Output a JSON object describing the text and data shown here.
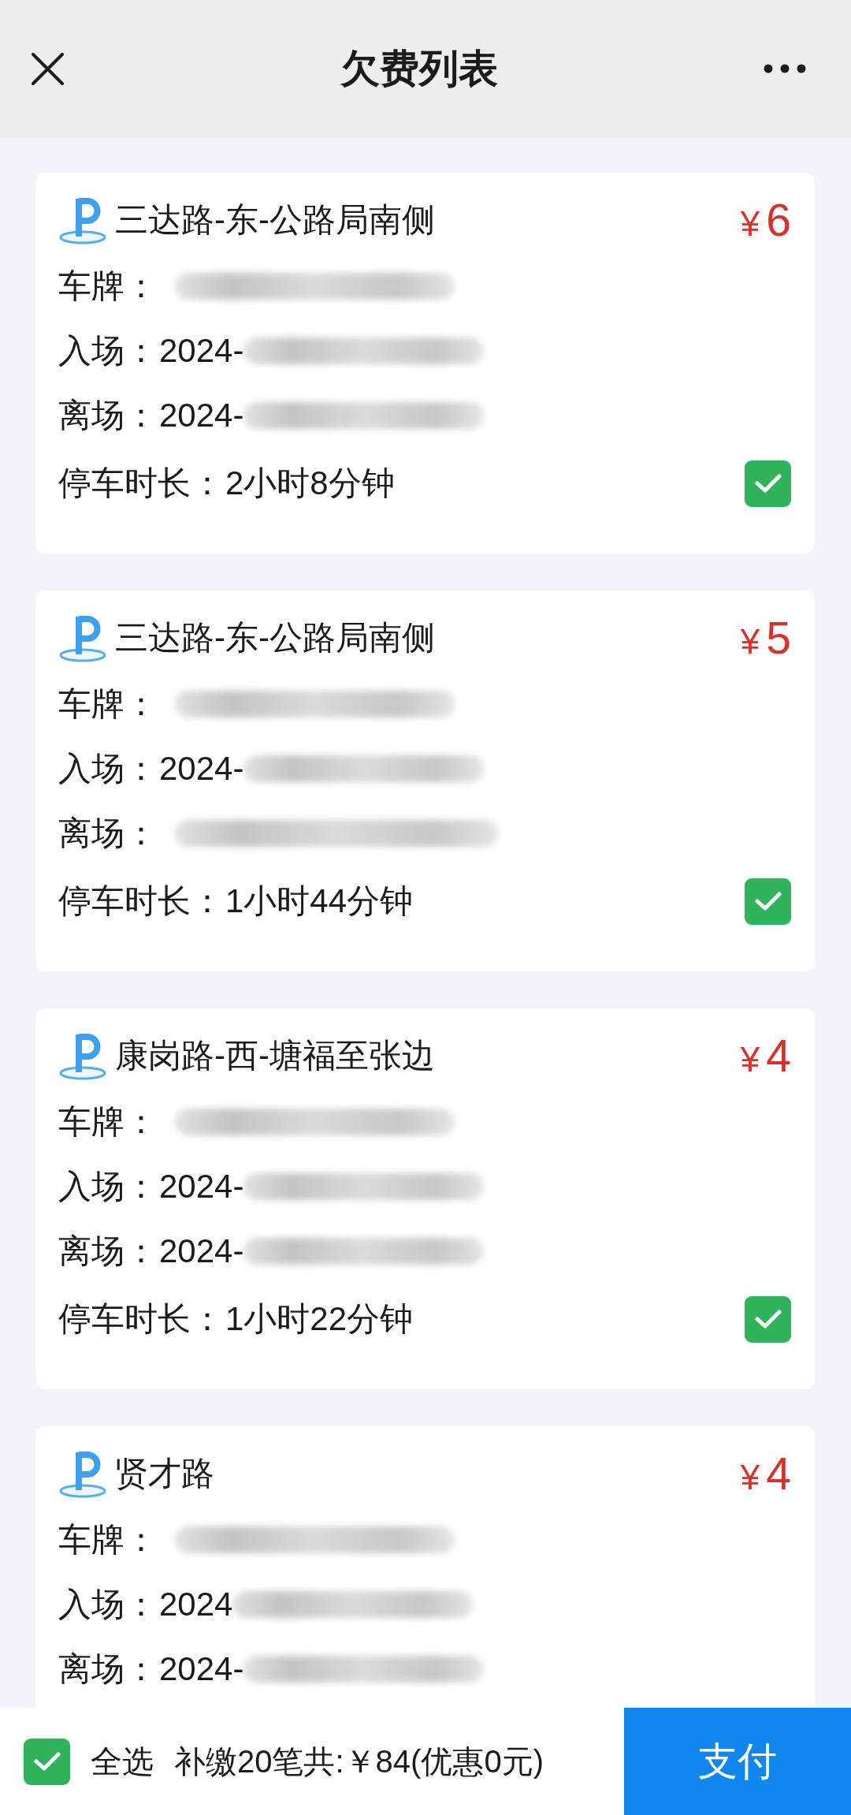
{
  "header": {
    "title": "欠费列表"
  },
  "cards": [
    {
      "location": "三达路-东-公路局南侧",
      "currency": "¥",
      "amount": "6",
      "fields": [
        {
          "kind": "plate",
          "label": "车牌：",
          "redacted": true
        },
        {
          "kind": "time",
          "label": "入场：",
          "value": "2024-",
          "redacted": true
        },
        {
          "kind": "time",
          "label": "离场：",
          "value": "2024-",
          "redacted": true
        }
      ],
      "duration": {
        "label": "停车时长：",
        "value": "2小时8分钟"
      },
      "checked": true
    },
    {
      "location": "三达路-东-公路局南侧",
      "currency": "¥",
      "amount": "5",
      "fields": [
        {
          "kind": "plate",
          "label": "车牌：",
          "redacted": true
        },
        {
          "kind": "time",
          "label": "入场：",
          "value": "2024-",
          "redacted": true
        },
        {
          "kind": "time",
          "label": "离场：",
          "redacted": true
        }
      ],
      "duration": {
        "label": "停车时长：",
        "value": "1小时44分钟"
      },
      "checked": true
    },
    {
      "location": "康岗路-西-塘福至张边",
      "currency": "¥",
      "amount": "4",
      "fields": [
        {
          "kind": "plate",
          "label": "车牌：",
          "redacted": true
        },
        {
          "kind": "time",
          "label": "入场：",
          "value": "2024-",
          "redacted": true
        },
        {
          "kind": "time",
          "label": "离场：",
          "value": "2024-",
          "redacted": true
        }
      ],
      "duration": {
        "label": "停车时长：",
        "value": "1小时22分钟"
      },
      "checked": true
    },
    {
      "location": "贤才路",
      "currency": "¥",
      "amount": "4",
      "fields": [
        {
          "kind": "plate",
          "label": "车牌：",
          "redacted": true
        },
        {
          "kind": "time",
          "label": "入场：",
          "value": "2024",
          "redacted": true
        },
        {
          "kind": "time",
          "label": "离场：",
          "value": "2024-",
          "redacted": true
        }
      ]
    }
  ],
  "footer": {
    "select_all": {
      "label": "全选",
      "checked": true
    },
    "summary": "补缴20笔共:￥84(优惠0元)",
    "pay_button": "支付"
  }
}
